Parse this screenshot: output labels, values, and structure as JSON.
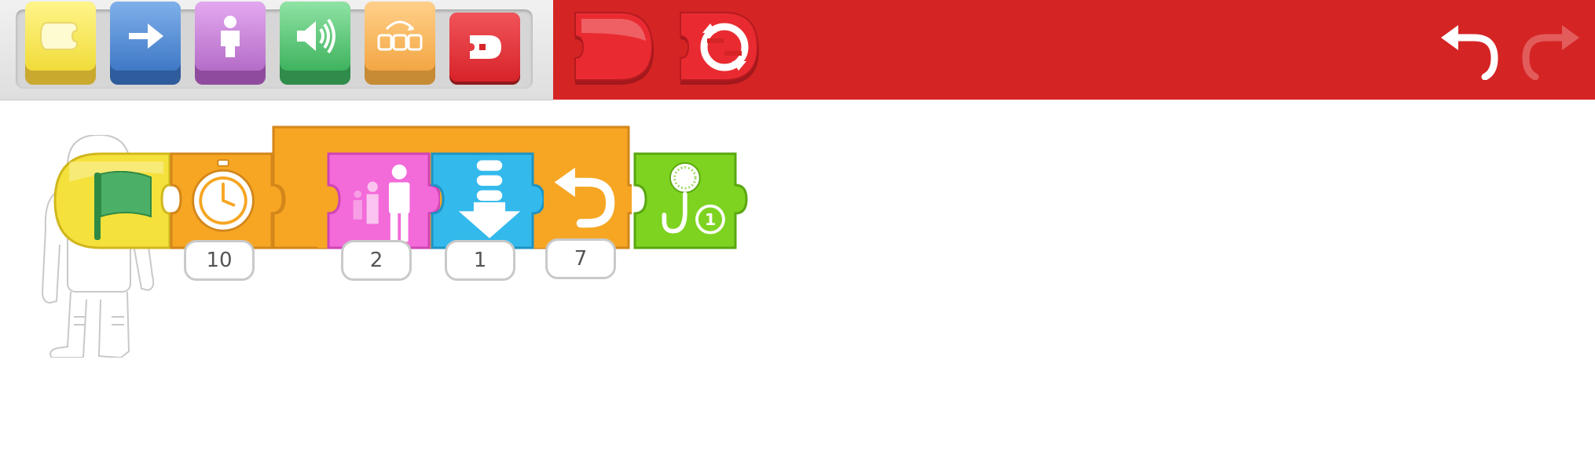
{
  "palette": {
    "categories": [
      {
        "id": "triggering",
        "icon": "trigger-block-icon",
        "color": "#f1dc3a"
      },
      {
        "id": "motion",
        "icon": "arrow-right-icon",
        "color": "#3f78c6"
      },
      {
        "id": "looks",
        "icon": "person-icon",
        "color": "#b56dc8"
      },
      {
        "id": "sound",
        "icon": "speaker-icon",
        "color": "#3fb35e"
      },
      {
        "id": "control",
        "icon": "control-blocks-icon",
        "color": "#f3a644"
      },
      {
        "id": "end",
        "icon": "end-block-icon",
        "color": "#d7232a",
        "selected": true
      }
    ],
    "end_blocks": [
      {
        "id": "end",
        "icon": "end-cap-icon"
      },
      {
        "id": "repeat-forever",
        "icon": "repeat-forever-icon"
      }
    ]
  },
  "toolbar": {
    "undo_icon": "undo-icon",
    "redo_icon": "redo-icon",
    "redo_enabled": false
  },
  "script": {
    "blocks": [
      {
        "type": "green-flag",
        "icon": "green-flag-icon",
        "color": "#f5e13c"
      },
      {
        "type": "wait",
        "icon": "stopwatch-icon",
        "color": "#f6a623",
        "param": "10"
      },
      {
        "type": "repeat",
        "icon": "repeat-icon",
        "color": "#f6a623",
        "param": "7"
      },
      {
        "type": "grow",
        "icon": "grow-person-icon",
        "color": "#f36ad9",
        "param": "2"
      },
      {
        "type": "move-down",
        "icon": "arrow-down-icon",
        "color": "#33b9ec",
        "param": "1"
      },
      {
        "type": "play-recorded-sound",
        "icon": "microphone-icon",
        "color": "#7ed321",
        "badge": "1"
      }
    ]
  },
  "sprite": {
    "name": "astronaut",
    "icon": "astronaut-icon"
  }
}
